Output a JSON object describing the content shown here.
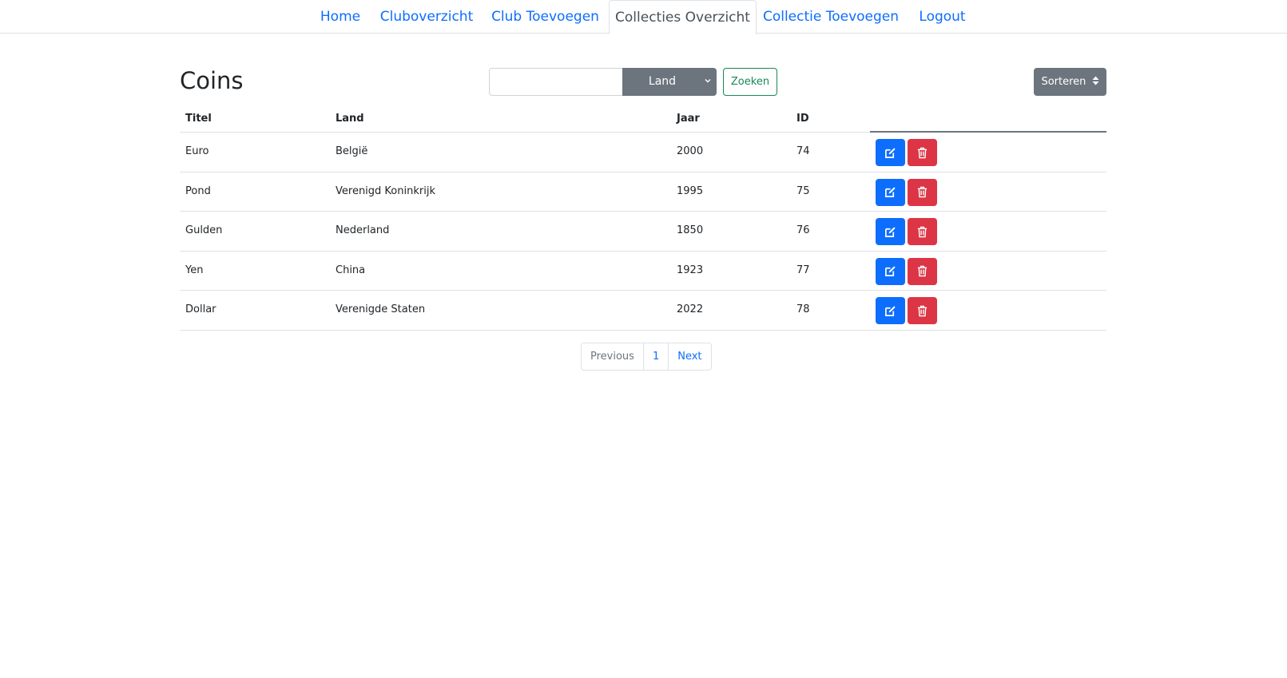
{
  "nav": {
    "items": [
      {
        "label": "Home"
      },
      {
        "label": "Cluboverzicht"
      },
      {
        "label": "Club Toevoegen"
      },
      {
        "label": "Collecties Overzicht"
      },
      {
        "label": "Collectie Toevoegen"
      },
      {
        "label": "Logout"
      }
    ],
    "active_index": 3
  },
  "page": {
    "title": "Coins"
  },
  "toolbar": {
    "search_value": "",
    "filter_selected": "Land",
    "search_button": "Zoeken",
    "sort_button": "Sorteren"
  },
  "table": {
    "headers": [
      "Titel",
      "Land",
      "Jaar",
      "ID"
    ],
    "rows": [
      {
        "titel": "Euro",
        "land": "België",
        "jaar": "2000",
        "id": "74"
      },
      {
        "titel": "Pond",
        "land": "Verenigd Koninkrijk",
        "jaar": "1995",
        "id": "75"
      },
      {
        "titel": "Gulden",
        "land": "Nederland",
        "jaar": "1850",
        "id": "76"
      },
      {
        "titel": "Yen",
        "land": "China",
        "jaar": "1923",
        "id": "77"
      },
      {
        "titel": "Dollar",
        "land": "Verenigde Staten",
        "jaar": "2022",
        "id": "78"
      }
    ],
    "row_actions": {
      "edit_icon": "edit-icon",
      "delete_icon": "trash-icon"
    }
  },
  "pagination": {
    "previous": "Previous",
    "pages": [
      "1"
    ],
    "next": "Next"
  },
  "colors": {
    "primary": "#0d6efd",
    "danger": "#dc3545",
    "secondary": "#6c757d",
    "success": "#198754"
  }
}
